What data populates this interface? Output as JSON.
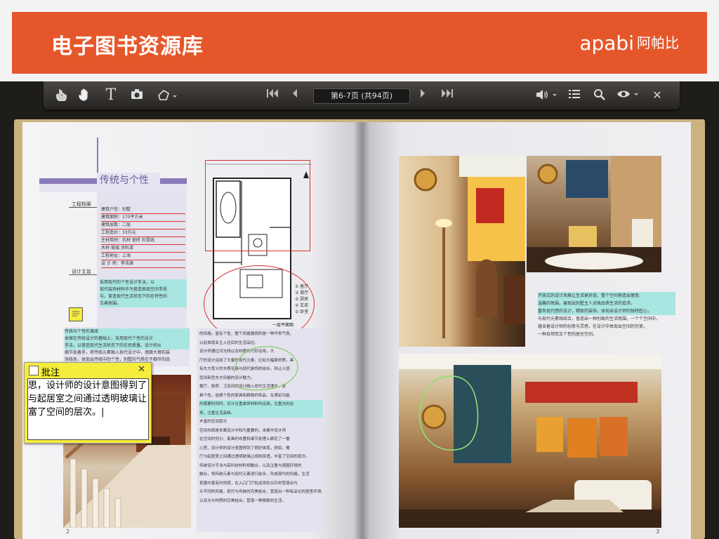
{
  "header": {
    "title": "电子图书资源库",
    "logo_text": "apabi",
    "logo_cn": "阿帕比"
  },
  "toolbar": {
    "page_indicator": "第6-7页 (共94页)"
  },
  "colors": {
    "brand": "#e5572b",
    "highlight": "#a8e6e2",
    "note_yellow": "#f5ec3c",
    "section_purple": "#8a7ab8"
  },
  "icons": [
    "hand-pointer-icon",
    "hand-drag-icon",
    "text-select-icon",
    "camera-icon",
    "shape-tool-icon",
    "first-page-icon",
    "prev-page-icon",
    "next-page-icon",
    "last-page-icon",
    "volume-icon",
    "list-icon",
    "search-icon",
    "eye-icon",
    "close-icon"
  ],
  "left_page": {
    "section_title": "传统与个性",
    "label_info": "工程档案",
    "label_designer": "设计主旨",
    "specs": [
      "建筑户型：别墅",
      "建筑面积：170平方米",
      "建筑层数：二层",
      "工程造价：33万元",
      "主材用材：石材  瓷砖  石膏线",
      "         木材  玻璃  涂料漆",
      "工程地址：上海",
      "设 计 师：李浩源"
    ],
    "designer_text": [
      "采用现代的个性设计手法，以",
      "现代装饰材料作为营造表现空间手段",
      "与，营造现代生活状态下的在特性的",
      "古典氛围。"
    ],
    "plan_label": "一层平面图",
    "plan_legend": [
      "① 客厅",
      "② 餐厅",
      "③ 厨房",
      "④ 车库",
      "⑤ 卧室"
    ],
    "highlight_lines": [
      "传统与个性的演绎",
      "本案在传统设计的基础上，采用现代个性的设计",
      "手法，以营造现代生活状态下的在民质量。设计师从",
      "细节处着手，将传统元素融入现代设计中，墙面大理石装",
      "饰线条，体现出传统中的个性，别墅的气质在于细节的品"
    ],
    "right_col_text": [
      "的风格。富有个性，整个风格展现的是一种华贵气氛，",
      "以此体现业主入住后的生活品位。",
      "设计师通过对光线以及材质的巧妙运用，大",
      "厅的设计运用了大量的现代元素，比如大幅面材质，具",
      "有东方意义的木质花格与现代装饰的结合，则让人感",
      "受到新型东方风格的设计魅力。",
      "餐厅、厨房、卫浴间的设计融入现代生活理念，更",
      "具个性。选择个性的家具和精致的饰品，在满足功能",
      "的需要的同时，设计注重装饰材料的运用，注重光的运",
      "用，注重生活品味。",
      "丰富的空间层次",
      "空间布局是本案设计中较为重要的，本案中设计师",
      "在空间的划分、家具的布置和细节处理上颇花了一番",
      "心思，设计师的设计意图得到了很好体现，例如，餐",
      "厅与起居室之间通过透明玻璃让视线穿透，丰富了空间的层次。",
      "",
      "传统设计手法与高科技材料相融合，以及注重与周围环境的",
      "融合，将传统元素与现代元素进行结合，形成现代的风格，生活",
      "氛围中富有时尚感，在入口门厅处运用仿古石材营造出与",
      "众不同的风格，现代与传统的完美结合，营造出一种有品位的居室环境。",
      "以及光与材质的完美结合，营造一种精致的生活。"
    ],
    "page_number": "2"
  },
  "right_page": {
    "caption_lines": [
      "开放式的设计风格让生活更舒适，整个空间营造出惬意、",
      "温馨的氛围，展现出别墅主人对高品质生活的追求。",
      "富有现代感的设计，精致的装饰，体现出设计师的独特匠心，",
      "与现代元素相结合，营造出一种别致的生活氛围，一个个空间中，",
      "蕴含着设计师的创意与灵感，在设计中体现出空间的完美，",
      "一种自然而又个性的居住空间。"
    ],
    "page_number": "3"
  },
  "note": {
    "title": "批注",
    "close": "✕",
    "lines": [
      "思，设计师的设计意图得到了",
      "与起居室之间通过透明玻璃让",
      "富了空间的层次。|"
    ]
  }
}
